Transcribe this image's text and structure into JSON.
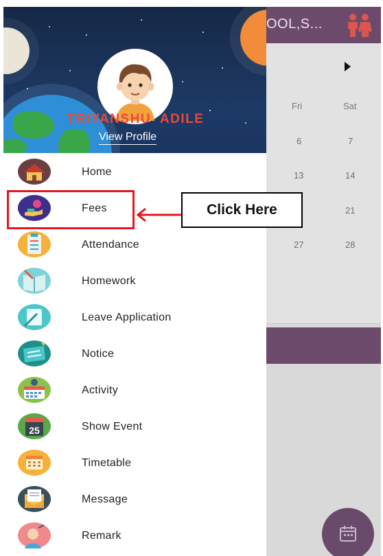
{
  "background": {
    "app_title": "OOL,S...",
    "calendar": {
      "day_names": [
        "Fri",
        "Sat"
      ],
      "dates": [
        [
          "6",
          "7"
        ],
        [
          "13",
          "14"
        ],
        [
          "",
          "21"
        ],
        [
          "27",
          "28"
        ]
      ]
    }
  },
  "drawer": {
    "user_name": "TRIYANSHU  ADILE",
    "view_profile": "View Profile",
    "items": [
      {
        "label": "Home",
        "icon": "home-icon"
      },
      {
        "label": "Fees",
        "icon": "fees-icon"
      },
      {
        "label": "Attendance",
        "icon": "attendance-icon"
      },
      {
        "label": "Homework",
        "icon": "homework-icon"
      },
      {
        "label": "Leave Application",
        "icon": "leave-application-icon"
      },
      {
        "label": "Notice",
        "icon": "notice-icon"
      },
      {
        "label": "Activity",
        "icon": "activity-icon"
      },
      {
        "label": "Show Event",
        "icon": "show-event-icon"
      },
      {
        "label": "Timetable",
        "icon": "timetable-icon"
      },
      {
        "label": "Message",
        "icon": "message-icon"
      },
      {
        "label": "Remark",
        "icon": "remark-icon"
      }
    ],
    "show_event_icon_text": "25"
  },
  "annotation": {
    "callout": "Click Here",
    "highlight_color": "#e4161e"
  },
  "colors": {
    "header_bg": "#1d3a66",
    "app_bar": "#6b4a6b",
    "user_name": "#e84a3a"
  }
}
